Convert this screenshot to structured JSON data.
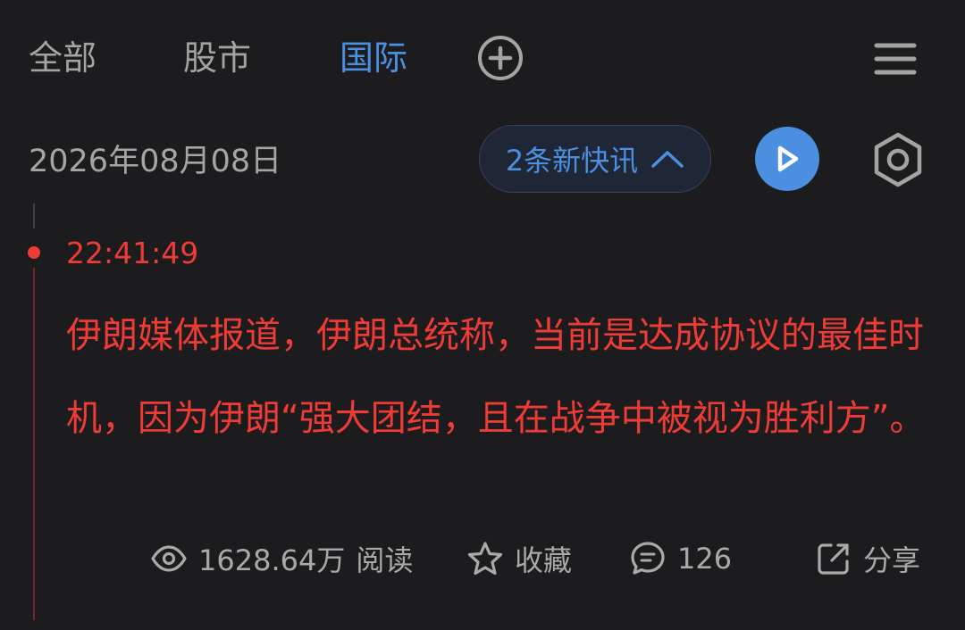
{
  "tabs": [
    {
      "label": "全部"
    },
    {
      "label": "股市"
    },
    {
      "label": "国际",
      "active": true
    }
  ],
  "header": {
    "add_tab_icon": "plus-circle-icon",
    "menu_icon": "hamburger-menu-icon"
  },
  "toolbar": {
    "date": "2026年08月08日",
    "new_badge": "2条新快讯",
    "badge_icon": "chevron-up-icon",
    "play_icon": "play-icon",
    "settings_icon": "hexagon-settings-icon"
  },
  "news": {
    "time": "22:41:49",
    "content": "伊朗媒体报道，伊朗总统称，当前是达成协议的最佳时机，因为伊朗“强大团结，且在战争中被视为胜利方”。"
  },
  "actions": {
    "read_count": "1628.64万",
    "read_label": "阅读",
    "favorite_label": "收藏",
    "comment_count": "126",
    "share_label": "分享"
  },
  "colors": {
    "background": "#1c1c1e",
    "accent": "#4a8fe0",
    "headline_red": "#ef3b36",
    "muted_text": "#a3a3a3"
  }
}
